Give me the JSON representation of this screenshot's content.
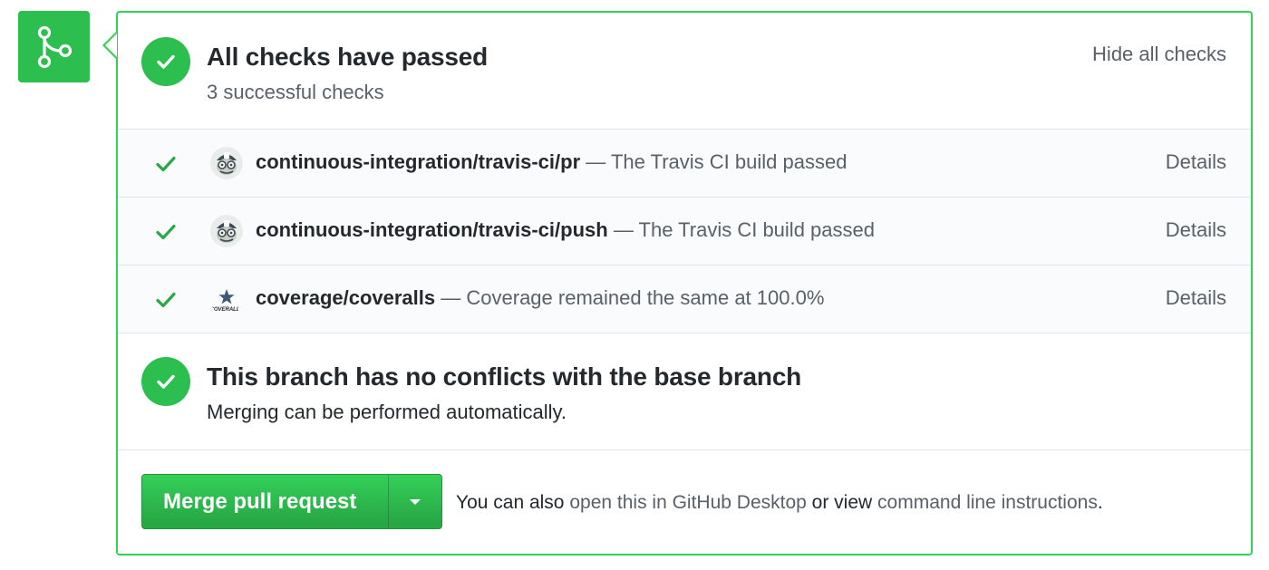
{
  "colors": {
    "success_green": "#2cbe4e",
    "border_green": "#34d058",
    "link_gray": "#586069",
    "text_dark": "#24292e"
  },
  "side_icon": {
    "icon": "git-merge-icon"
  },
  "checks": {
    "title": "All checks have passed",
    "subtitle": "3 successful checks",
    "toggle_label": "Hide all checks",
    "status_icon": "check-circle-icon",
    "items": [
      {
        "context": "continuous-integration/travis-ci/pr",
        "description": "— The Travis CI build passed",
        "details_label": "Details",
        "avatar": "travis-ci-avatar"
      },
      {
        "context": "continuous-integration/travis-ci/push",
        "description": "— The Travis CI build passed",
        "details_label": "Details",
        "avatar": "travis-ci-avatar"
      },
      {
        "context": "coverage/coveralls",
        "description": "— Coverage remained the same at 100.0%",
        "details_label": "Details",
        "avatar": "coveralls-avatar",
        "avatar_text": "COVERALLS"
      }
    ]
  },
  "conflicts": {
    "title": "This branch has no conflicts with the base branch",
    "subtitle": "Merging can be performed automatically.",
    "status_icon": "check-circle-icon"
  },
  "merge": {
    "button_label": "Merge pull request",
    "dropdown_icon": "triangle-down-icon",
    "info_prefix": "You can also",
    "desktop_link": "open this in GitHub Desktop",
    "info_middle": "or view",
    "cli_link": "command line instructions",
    "info_suffix": "."
  }
}
